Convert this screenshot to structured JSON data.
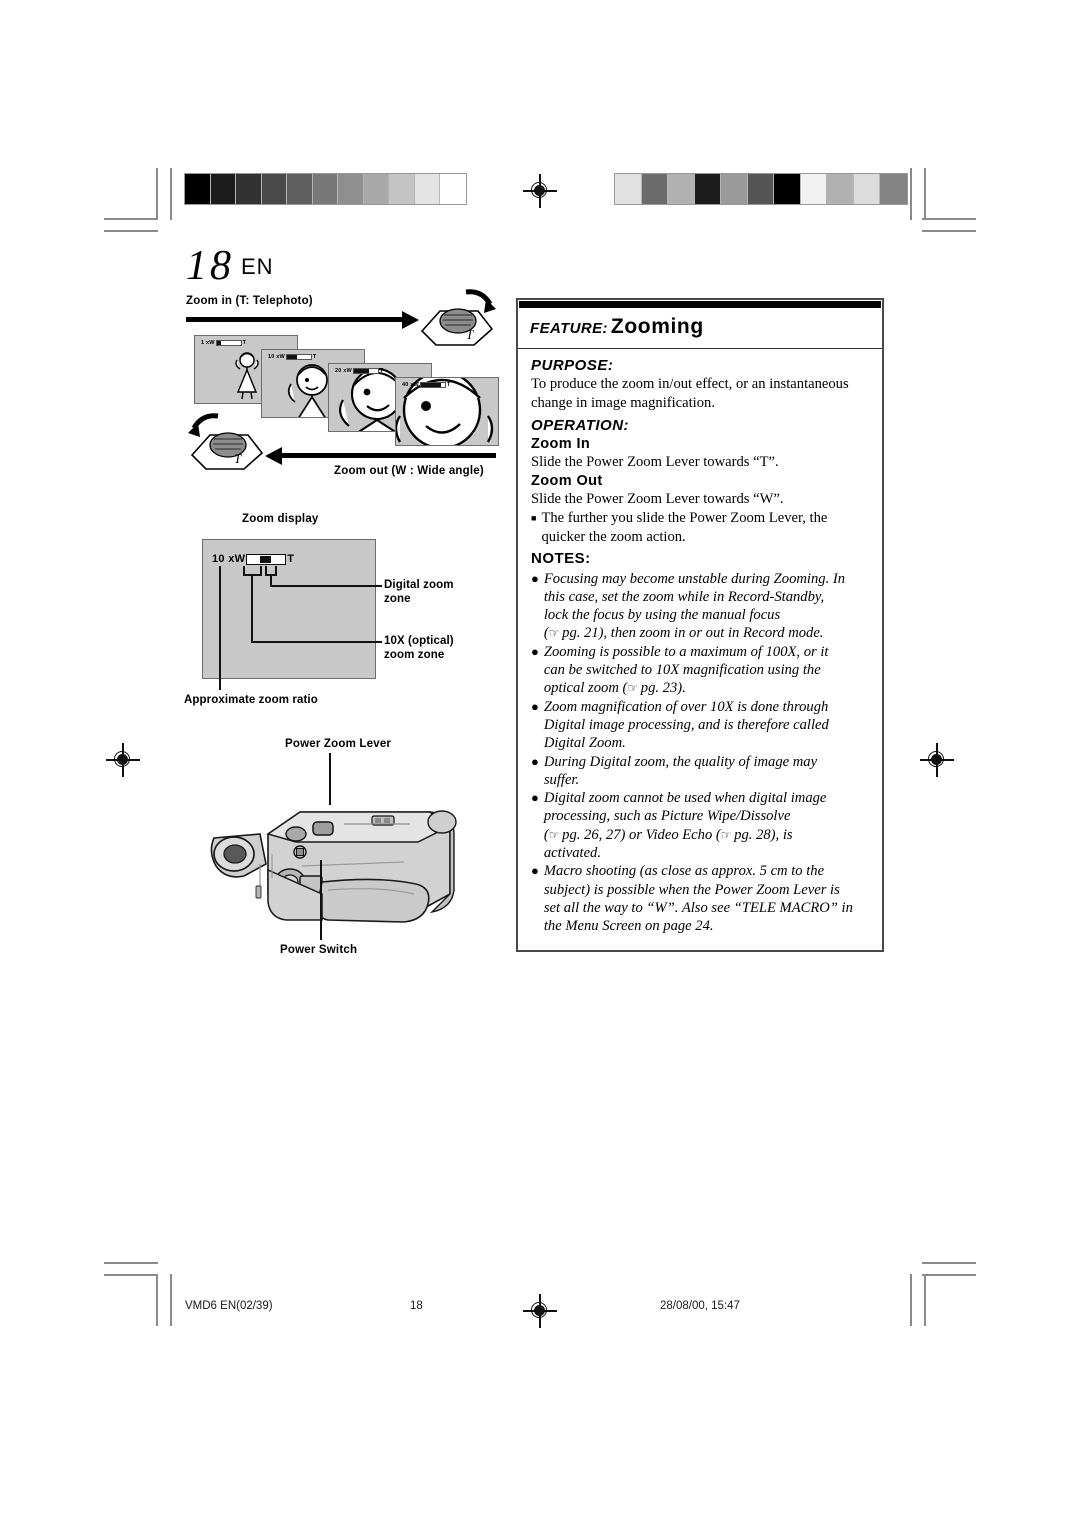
{
  "page": {
    "number": "18",
    "lang": "EN"
  },
  "figures": {
    "zoom_in_label": "Zoom in (T: Telephoto)",
    "zoom_out_label": "Zoom out (W : Wide angle)",
    "zoom_display_label": "Zoom display",
    "screens": [
      {
        "ratio": "1 x",
        "w": "W",
        "t": "T",
        "fill_pct": 18
      },
      {
        "ratio": "10 x",
        "w": "W",
        "t": "T",
        "fill_pct": 42
      },
      {
        "ratio": "20 x",
        "w": "W",
        "t": "T",
        "fill_pct": 62
      },
      {
        "ratio": "40 x",
        "w": "W",
        "t": "T",
        "fill_pct": 82
      }
    ],
    "zoom_display": {
      "ratio": "10 x",
      "w": "W",
      "t": "T",
      "callouts": {
        "digital_zone": "Digital zoom\nzone",
        "digital_zone_l1": "Digital zoom",
        "digital_zone_l2": "zone",
        "optical_zone_l1": "10X (optical)",
        "optical_zone_l2": "zoom zone",
        "approx_ratio": "Approximate zoom ratio"
      }
    },
    "camcorder": {
      "power_zoom_lever": "Power Zoom Lever",
      "power_switch": "Power Switch"
    }
  },
  "feature": {
    "kicker": "FEATURE:",
    "title": "Zooming",
    "purpose_label": "PURPOSE:",
    "purpose_lines": [
      "To produce the zoom in/out effect, or an instantaneous",
      "change in image magnification."
    ],
    "operation_label": "OPERATION:",
    "zoom_in_label": "Zoom In",
    "zoom_in_text": "Slide the Power Zoom Lever towards “T”.",
    "zoom_out_label": "Zoom Out",
    "zoom_out_text": "Slide the Power Zoom Lever towards “W”.",
    "operation_bullet": {
      "marker": "■",
      "line1": "The further you slide the Power Zoom Lever, the",
      "line2": "quicker the zoom action."
    },
    "notes_label": "NOTES:",
    "notes": [
      {
        "marker": "●",
        "lines": [
          "Focusing may become unstable during Zooming. In",
          "this case, set the zoom while in Record-Standby,",
          "lock the focus by using the manual focus",
          "(☞ pg. 21), then zoom in or out in Record mode."
        ]
      },
      {
        "marker": "●",
        "lines": [
          "Zooming is possible to a maximum of 100X, or it",
          "can be switched to 10X magnification using the",
          "optical zoom (☞ pg. 23)."
        ]
      },
      {
        "marker": "●",
        "lines": [
          "Zoom magnification of over 10X is done through",
          "Digital image processing, and is therefore called",
          "Digital Zoom."
        ]
      },
      {
        "marker": "●",
        "lines": [
          "During Digital zoom, the quality of image may",
          "suffer."
        ]
      },
      {
        "marker": "●",
        "lines": [
          "Digital zoom cannot be used when digital image",
          "processing, such as Picture Wipe/Dissolve",
          "(☞ pg. 26, 27) or Video Echo (☞ pg. 28), is",
          "activated."
        ]
      },
      {
        "marker": "●",
        "lines": [
          "Macro shooting (as close as approx. 5 cm to the",
          "subject) is possible when the Power Zoom Lever is",
          "set all the way to “W”. Also see “TELE MACRO” in",
          "the Menu Screen on page 24."
        ]
      }
    ]
  },
  "footer": {
    "file": "VMD6 EN(02/39)",
    "page": "18",
    "timestamp": "28/08/00, 15:47"
  },
  "print_marks": {
    "gray_bar_left": [
      "#000000",
      "#1c1c1c",
      "#323232",
      "#494949",
      "#5f5f5f",
      "#787878",
      "#8f8f8f",
      "#a8a8a8",
      "#c4c4c4",
      "#e4e4e4",
      "#ffffff"
    ],
    "gray_bar_right": [
      "#e2e2e2",
      "#6b6b6b",
      "#b1b1b1",
      "#1c1c1c",
      "#9a9a9a",
      "#555555",
      "#000000",
      "#f2f2f2",
      "#b1b1b1",
      "#dcdcdc",
      "#848484"
    ]
  }
}
